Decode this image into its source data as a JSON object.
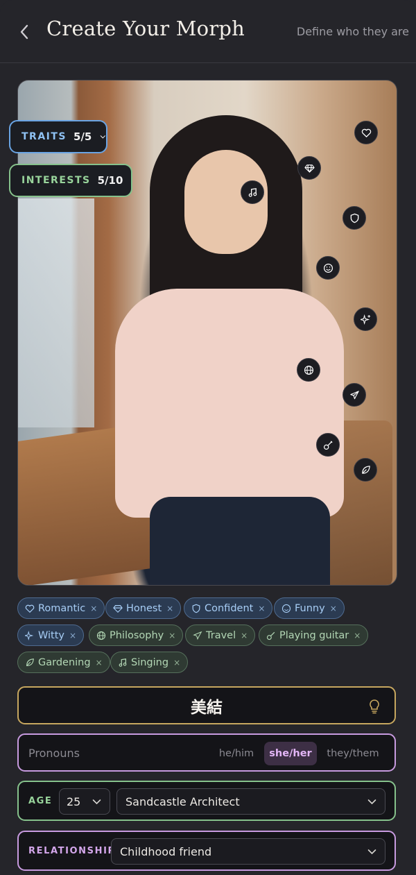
{
  "header": {
    "title": "Create Your Morph",
    "subtitle": "Define who they are"
  },
  "selectors": {
    "traits": {
      "label": "TRAITS",
      "count": "5/5"
    },
    "interests": {
      "label": "INTERESTS",
      "count": "5/10"
    }
  },
  "floating_icons": [
    "heart-icon",
    "gem-icon",
    "music-icon",
    "shield-icon",
    "smile-icon",
    "sparkles-icon",
    "globe-icon",
    "plane-icon",
    "guitar-icon",
    "leaf-icon"
  ],
  "chips": {
    "traits": [
      {
        "label": "Romantic",
        "icon": "heart-icon"
      },
      {
        "label": "Honest",
        "icon": "gem-icon"
      },
      {
        "label": "Confident",
        "icon": "shield-icon"
      },
      {
        "label": "Funny",
        "icon": "smile-icon"
      },
      {
        "label": "Witty",
        "icon": "sparkles-icon"
      }
    ],
    "interests": [
      {
        "label": "Philosophy",
        "icon": "globe-icon"
      },
      {
        "label": "Travel",
        "icon": "plane-icon"
      },
      {
        "label": "Playing guitar",
        "icon": "guitar-icon"
      },
      {
        "label": "Gardening",
        "icon": "leaf-icon"
      },
      {
        "label": "Singing",
        "icon": "music-icon"
      }
    ],
    "remove_glyph": "×"
  },
  "name": {
    "value": "美結"
  },
  "pronouns": {
    "label": "Pronouns",
    "options": [
      "he/him",
      "she/her",
      "they/them"
    ],
    "selected": "she/her"
  },
  "age": {
    "label": "AGE",
    "value": "25",
    "occupation": "Sandcastle Architect"
  },
  "relationship": {
    "label": "RELATIONSHIP",
    "value": "Childhood friend"
  },
  "colors": {
    "background": "#25252a",
    "traits_accent": "#6aa4e3",
    "interests_accent": "#86c28c",
    "name_accent": "#c7a75f",
    "pronoun_accent": "#c89be0"
  }
}
